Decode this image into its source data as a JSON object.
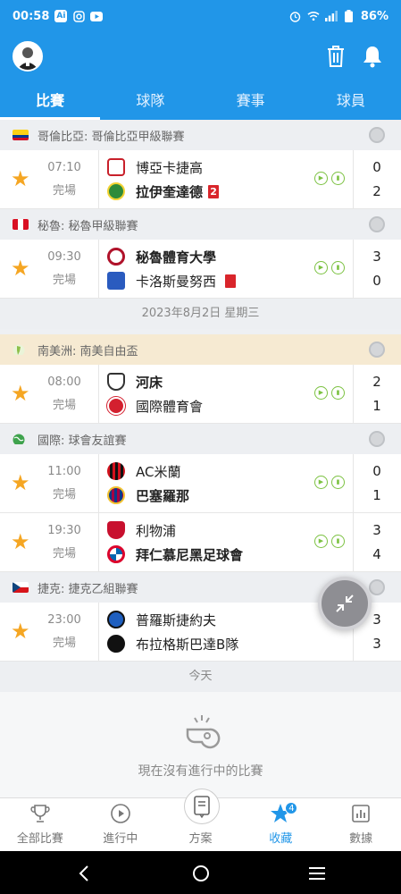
{
  "status_bar": {
    "time": "00:58",
    "battery": "86%",
    "app_icons": [
      "Ai",
      "instagram-icon",
      "youtube-icon"
    ]
  },
  "header": {
    "icons": [
      "user-avatar",
      "trash-icon",
      "bell-icon"
    ],
    "accent": "#2196e8"
  },
  "tabs": [
    {
      "label": "比賽",
      "active": true
    },
    {
      "label": "球隊",
      "active": false
    },
    {
      "label": "賽事",
      "active": false
    },
    {
      "label": "球員",
      "active": false
    }
  ],
  "sections": [
    {
      "league": "哥倫比亞: 哥倫比亞甲級聯賽",
      "flag": "colombia",
      "matches": [
        {
          "time": "07:10",
          "status": "完場",
          "home": "博亞卡捷高",
          "away": "拉伊奎達德",
          "home_score": "0",
          "away_score": "2",
          "away_red_cards": "2",
          "winner": "away"
        }
      ]
    },
    {
      "league": "秘魯: 秘魯甲級聯賽",
      "flag": "peru",
      "matches": [
        {
          "time": "09:30",
          "status": "完場",
          "home": "秘魯體育大學",
          "away": "卡洛斯曼努西",
          "home_score": "3",
          "away_score": "0",
          "away_red_card": true,
          "winner": "home"
        }
      ]
    },
    {
      "date_separator": "2023年8月2日 星期三"
    },
    {
      "league": "南美洲: 南美自由盃",
      "flag": "south-america",
      "matches": [
        {
          "time": "08:00",
          "status": "完場",
          "home": "河床",
          "away": "國際體育會",
          "home_score": "2",
          "away_score": "1",
          "winner": "home"
        }
      ]
    },
    {
      "league": "國際: 球會友誼賽",
      "flag": "world",
      "matches": [
        {
          "time": "11:00",
          "status": "完場",
          "home": "AC米蘭",
          "away": "巴塞羅那",
          "home_score": "0",
          "away_score": "1",
          "winner": "away"
        },
        {
          "time": "19:30",
          "status": "完場",
          "home": "利物浦",
          "away": "拜仁慕尼黑足球會",
          "home_score": "3",
          "away_score": "4",
          "winner": "away"
        }
      ]
    },
    {
      "league": "捷克: 捷克乙組聯賽",
      "flag": "czech",
      "matches": [
        {
          "time": "23:00",
          "status": "完場",
          "home": "普羅斯捷約夫",
          "away": "布拉格斯巴達B隊",
          "home_score": "3",
          "away_score": "3",
          "winner": "none"
        }
      ]
    }
  ],
  "today": {
    "label": "今天",
    "empty_text": "現在沒有進行中的比賽"
  },
  "bottom_nav": [
    {
      "label": "全部比賽",
      "icon": "trophy-icon",
      "active": false
    },
    {
      "label": "進行中",
      "icon": "play-icon",
      "active": false
    },
    {
      "label": "方案",
      "icon": "document-icon",
      "active": false
    },
    {
      "label": "收藏",
      "icon": "star-icon",
      "active": true,
      "badge": "4"
    },
    {
      "label": "數據",
      "icon": "bar-chart-icon",
      "active": false
    }
  ]
}
